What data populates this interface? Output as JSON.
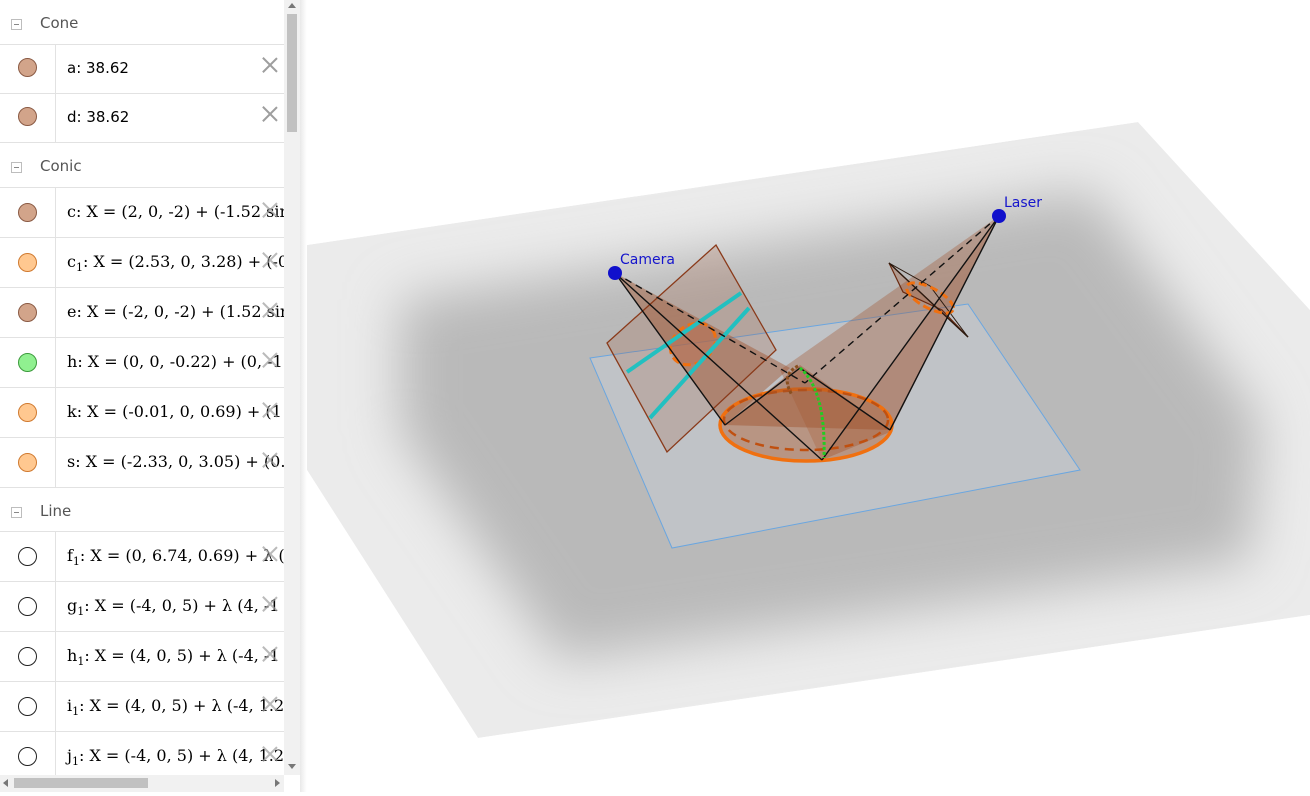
{
  "algebra": {
    "groups": [
      {
        "label": "Cone",
        "items": [
          {
            "name": "a",
            "text": "a: 38.62",
            "color": "#d2a48a"
          },
          {
            "name": "d",
            "text": "d: 38.62",
            "color": "#d2a48a"
          }
        ]
      },
      {
        "label": "Conic",
        "items": [
          {
            "name": "c",
            "pre": "c",
            "sub": "",
            "text": ": X = (2, 0, -2) + (-1.52 sin",
            "color": "#d2a48a"
          },
          {
            "name": "c1",
            "pre": "c",
            "sub": "1",
            "text": ": X = (2.53, 0, 3.28) + (-0",
            "color": "#ffc890"
          },
          {
            "name": "e",
            "pre": "e",
            "sub": "",
            "text": ": X = (-2, 0, -2) + (1.52 sin",
            "color": "#d2a48a"
          },
          {
            "name": "h",
            "pre": "h",
            "sub": "",
            "text": ": X = (0, 0, -0.22) + (0, -1",
            "color": "#90f090"
          },
          {
            "name": "k",
            "pre": "k",
            "sub": "",
            "text": ": X = (-0.01, 0, 0.69) + (1",
            "color": "#ffc890"
          },
          {
            "name": "s",
            "pre": "s",
            "sub": "",
            "text": ": X = (-2.33, 0, 3.05) + (0.",
            "color": "#ffc890"
          }
        ]
      },
      {
        "label": "Line",
        "items": [
          {
            "name": "f1",
            "pre": "f",
            "sub": "1",
            "text": ": X = (0, 6.74, 0.69) + λ (",
            "color": "#ffffff"
          },
          {
            "name": "g1",
            "pre": "g",
            "sub": "1",
            "text": ": X = (-4, 0, 5) + λ (4, -1",
            "color": "#ffffff"
          },
          {
            "name": "h1",
            "pre": "h",
            "sub": "1",
            "text": ": X = (4, 0, 5) + λ (-4, -1",
            "color": "#ffffff"
          },
          {
            "name": "i1",
            "pre": "i",
            "sub": "1",
            "text": ": X = (4, 0, 5) + λ (-4, 1.2",
            "color": "#ffffff"
          },
          {
            "name": "j1",
            "pre": "j",
            "sub": "1",
            "text": ": X = (-4, 0, 5) + λ (4, 1.2",
            "color": "#ffffff"
          }
        ]
      }
    ]
  },
  "view3d": {
    "points": [
      {
        "label": "Camera",
        "color": "#1010cc"
      },
      {
        "label": "Laser",
        "color": "#1010cc"
      }
    ],
    "colors": {
      "cone_fill": "#a0522d",
      "conic_orange": "#f07010",
      "laser_line_cyan": "#22c0c0",
      "curve_green": "#22cc22",
      "plane_edge": "#6aa6e0",
      "ground": "#c8c8c8"
    }
  }
}
